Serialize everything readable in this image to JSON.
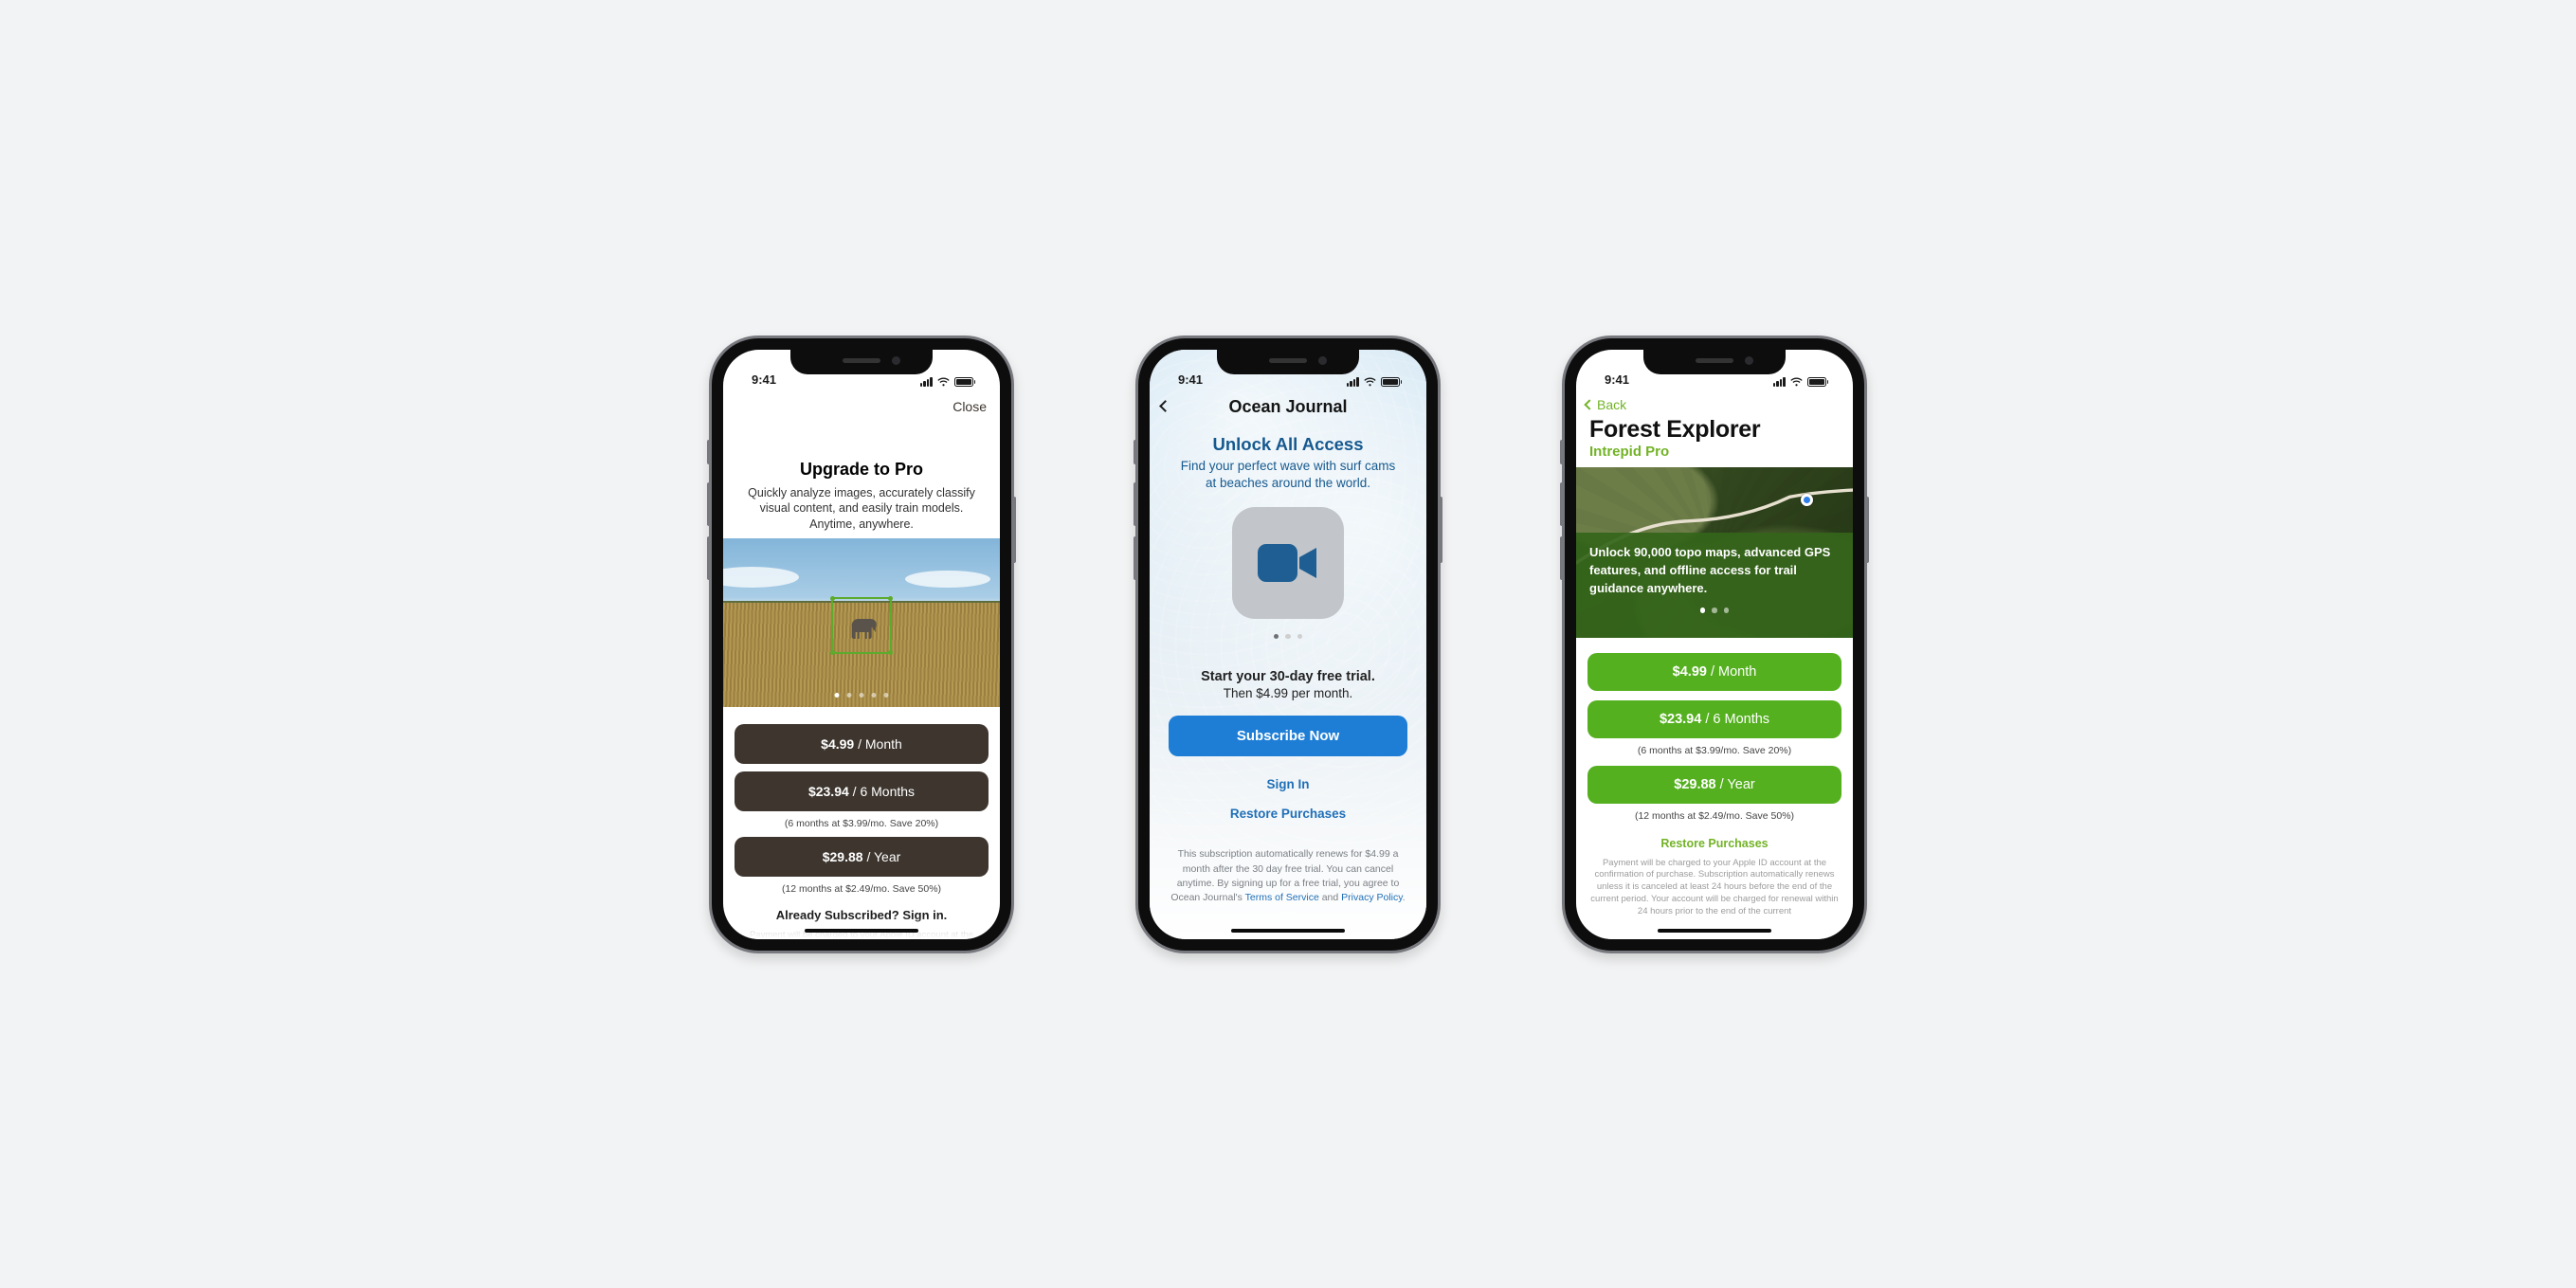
{
  "status_time": "9:41",
  "phone1": {
    "close": "Close",
    "title": "Upgrade to Pro",
    "subtitle": "Quickly analyze images, accurately classify visual content, and easily train models. Anytime, anywhere.",
    "plans": [
      {
        "price": "$4.99",
        "period": " / Month",
        "note": ""
      },
      {
        "price": "$23.94",
        "period": " / 6 Months",
        "note": "(6 months at $3.99/mo. Save 20%)"
      },
      {
        "price": "$29.88",
        "period": " / Year",
        "note": "(12 months at $2.49/mo. Save 50%)"
      }
    ],
    "sign_in": "Already Subscribed? Sign in.",
    "legal": "Payment will be charged to your Apple ID account at the confirmation of purchase. Subscription automatically renews unless it is canceled at least 24 hours before the end of the current period. Your account will be charged for renewal within 24 hours prior to the end of the current"
  },
  "phone2": {
    "nav_title": "Ocean Journal",
    "headline": "Unlock All Access",
    "subline": "Find your perfect wave with surf cams at beaches around the world.",
    "trial": "Start your 30-day free trial.",
    "then": "Then $4.99 per month.",
    "cta": "Subscribe Now",
    "sign_in": "Sign In",
    "restore": "Restore Purchases",
    "disclaimer_1": "This subscription automatically renews for $4.99 a month after the 30 day free trial. You can cancel anytime. By signing up for a free trial, you agree to Ocean Journal's ",
    "tos": "Terms of Service",
    "and": " and ",
    "privacy": "Privacy Policy",
    "period": "."
  },
  "phone3": {
    "back": "Back",
    "app_name": "Forest Explorer",
    "tier": "Intrepid Pro",
    "overlay": "Unlock 90,000 topo maps, advanced GPS features, and offline access for trail guidance anywhere.",
    "plans": [
      {
        "price": "$4.99",
        "period": " / Month",
        "note": ""
      },
      {
        "price": "$23.94",
        "period": " / 6 Months",
        "note": "(6 months at $3.99/mo. Save 20%)"
      },
      {
        "price": "$29.88",
        "period": " / Year",
        "note": "(12 months at $2.49/mo. Save 50%)"
      }
    ],
    "restore": "Restore Purchases",
    "legal": "Payment will be charged to your Apple ID account at the confirmation of purchase. Subscription automatically renews unless it is canceled at least 24 hours before the end of the current period. Your account will be charged for renewal within 24 hours prior to the end of the current"
  }
}
